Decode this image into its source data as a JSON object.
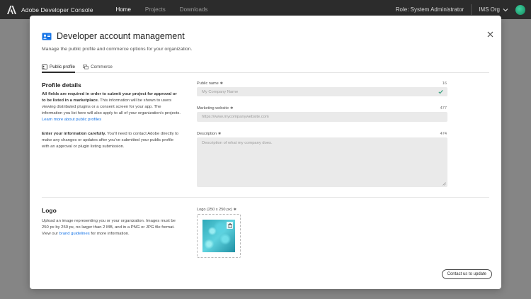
{
  "topbar": {
    "brand": "Adobe Developer Console",
    "nav": [
      {
        "label": "Home",
        "active": true
      },
      {
        "label": "Projects",
        "active": false
      },
      {
        "label": "Downloads",
        "active": false
      }
    ],
    "role": "Role: System Administrator",
    "org": "IMS Org"
  },
  "modal": {
    "title": "Developer account management",
    "subtitle": "Manage the public profile and commerce options for your organization.",
    "tabs": [
      {
        "label": "Public profile",
        "active": true,
        "icon": "profile-card-icon"
      },
      {
        "label": "Commerce",
        "active": false,
        "icon": "commerce-icon"
      }
    ],
    "profile": {
      "heading": "Profile details",
      "para1_bold": "All fields are required in order to submit your project for approval or to be listed in a marketplace.",
      "para1_rest": " This information will be shown to users viewing distributed plugins or a consent screen for your app. The information you list here will also apply to all of your organization’s projects. ",
      "para1_link": "Learn more about public profiles",
      "para2_bold": "Enter your information carefully.",
      "para2_rest": " You’ll need to contact Adobe directly to make any changes or updates after you’ve submitted your public profile with an approval or plugin listing submission."
    },
    "fields": {
      "public_name": {
        "label": "Public name",
        "count": "16",
        "placeholder": "My Company Name"
      },
      "website": {
        "label": "Marketing website",
        "count": "477",
        "placeholder": "https://www.mycompanywebsite.com"
      },
      "description": {
        "label": "Description",
        "count": "474",
        "placeholder": "Description of what my company does."
      }
    },
    "logo": {
      "heading": "Logo",
      "para_rest": "Upload an image representing you or your organization. Images must be 250 px by 250 px, no larger than 2 MB, and in a PNG or JPG file format. View our ",
      "para_link": "brand guidelines",
      "para_end": " for more information.",
      "field_label": "Logo (250 x 250 px)"
    },
    "contact_button": "Contact us to update"
  },
  "colors": {
    "accent": "#1473e6",
    "success": "#2d9d78",
    "topbar": "#2c2c2c"
  }
}
